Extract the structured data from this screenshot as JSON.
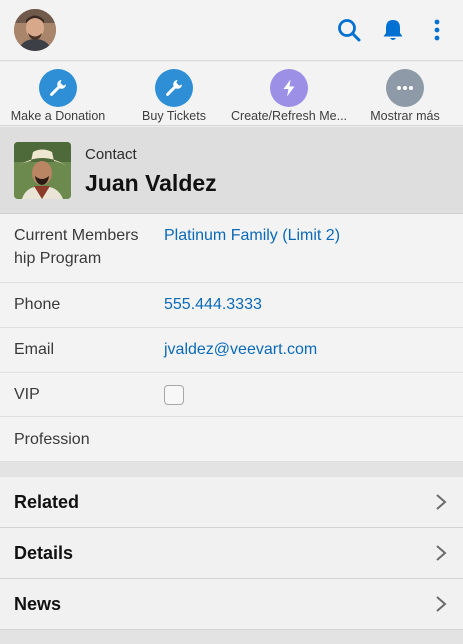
{
  "user": {
    "avatar_icon": "user-avatar-photo"
  },
  "topbar": {
    "icons": [
      "search-icon",
      "bell-icon",
      "more-vertical-icon"
    ],
    "accent": "#0070d2"
  },
  "actions": [
    {
      "label": "Make a Donation",
      "icon": "wrench-icon",
      "color": "#2e8fd6"
    },
    {
      "label": "Buy Tickets",
      "icon": "wrench-icon",
      "color": "#2e8fd6"
    },
    {
      "label": "Create/Refresh Me...",
      "icon": "lightning-icon",
      "color": "#9c8fe6"
    },
    {
      "label": "Mostrar más",
      "icon": "more-horizontal-icon",
      "color": "#8e9aa8"
    }
  ],
  "record": {
    "object_type": "Contact",
    "name": "Juan Valdez"
  },
  "fields": [
    {
      "label_line1": "Current Members",
      "label_line2": "hip Program",
      "value": "Platinum Family (Limit 2)"
    },
    {
      "label": "Phone",
      "value": "555.444.3333"
    },
    {
      "label": "Email",
      "value": "jvaldez@veevart.com"
    },
    {
      "label": "VIP",
      "checked": false
    },
    {
      "label": "Profession",
      "value": ""
    }
  ],
  "sections": [
    {
      "name": "Related"
    },
    {
      "name": "Details"
    },
    {
      "name": "News"
    }
  ]
}
